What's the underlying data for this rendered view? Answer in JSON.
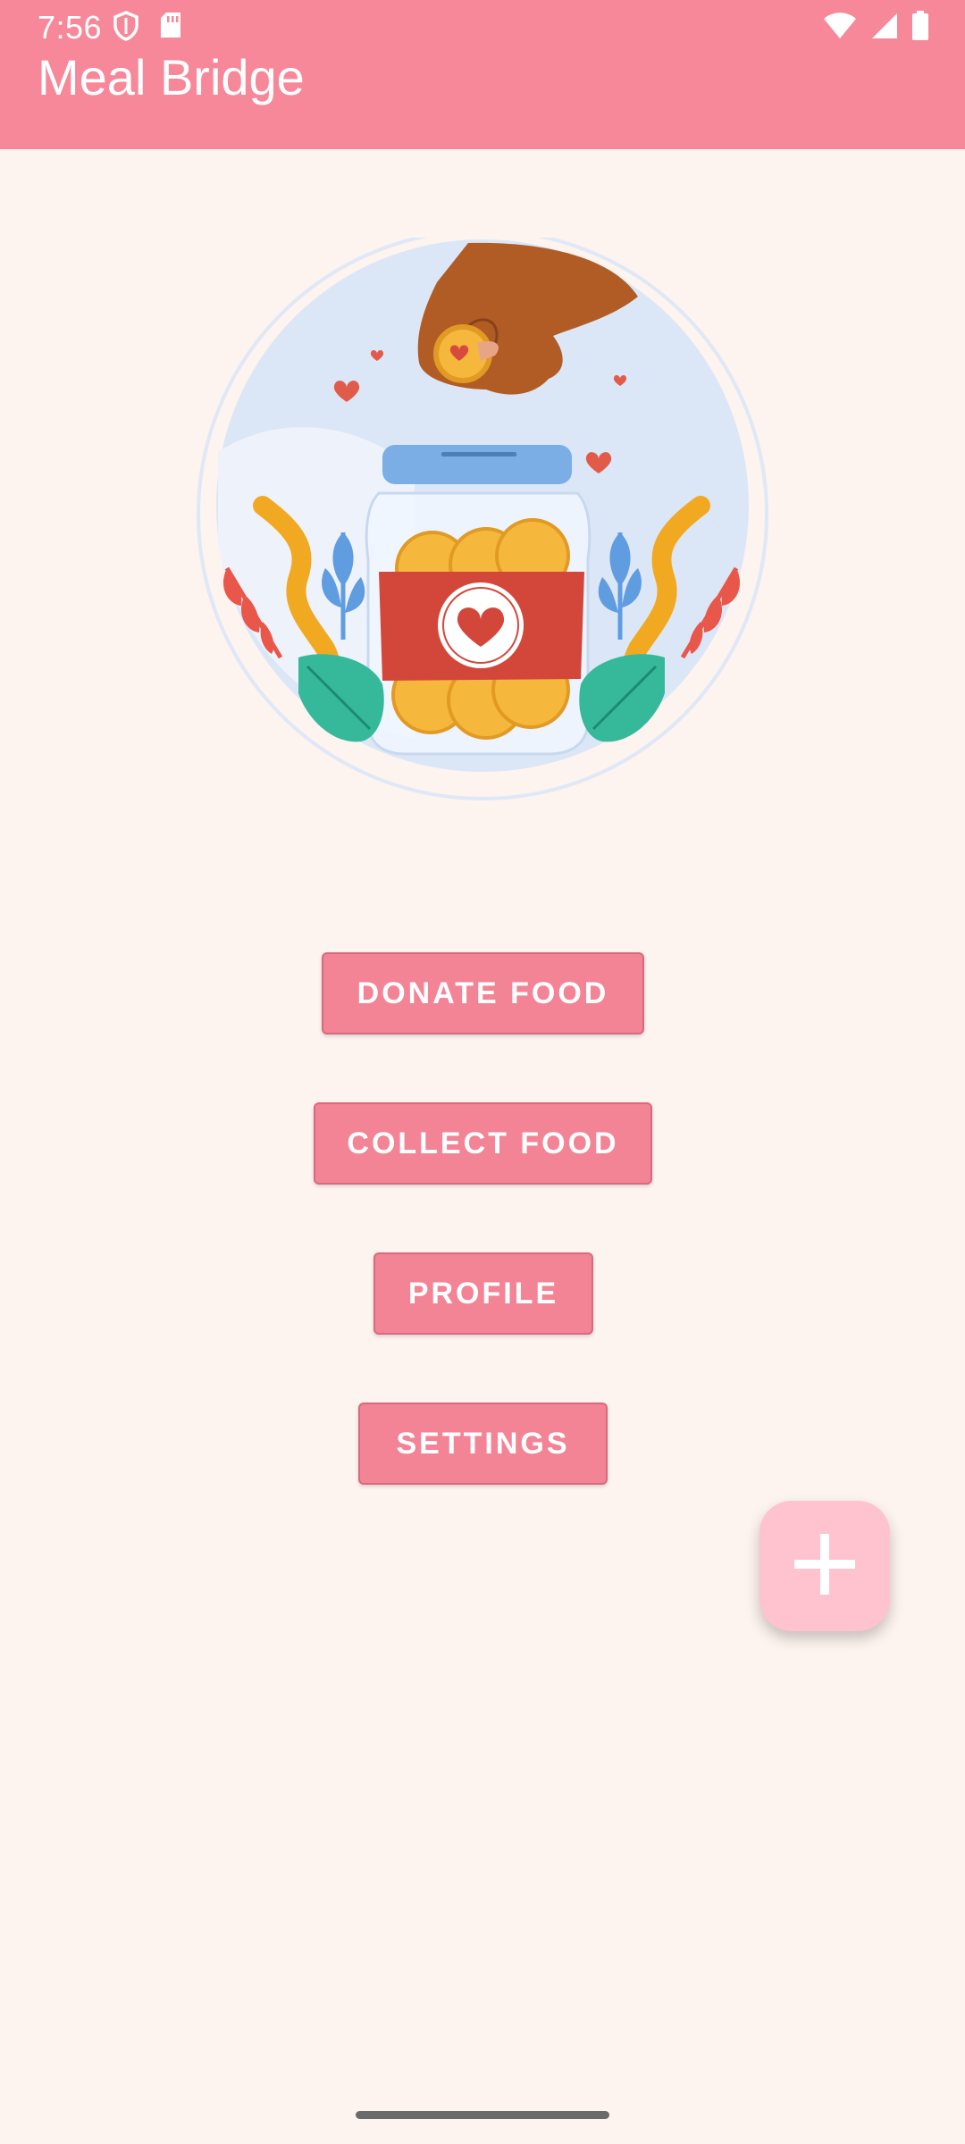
{
  "status_bar": {
    "time": "7:56",
    "left_icons": [
      "shield-icon",
      "sd-card-icon"
    ],
    "right_icons": [
      "wifi-icon",
      "signal-icon",
      "battery-icon"
    ]
  },
  "app_bar": {
    "title": "Meal Bridge",
    "background": "#f7889a"
  },
  "hero": {
    "description_icon": "donation-jar-illustration"
  },
  "buttons": {
    "donate": "DONATE FOOD",
    "collect": "COLLECT FOOD",
    "profile": "PROFILE",
    "settings": "SETTINGS"
  },
  "fab": {
    "icon": "plus-icon",
    "color": "#ffc2cf"
  },
  "colors": {
    "background": "#fdf3ef",
    "button": "#f38496"
  }
}
